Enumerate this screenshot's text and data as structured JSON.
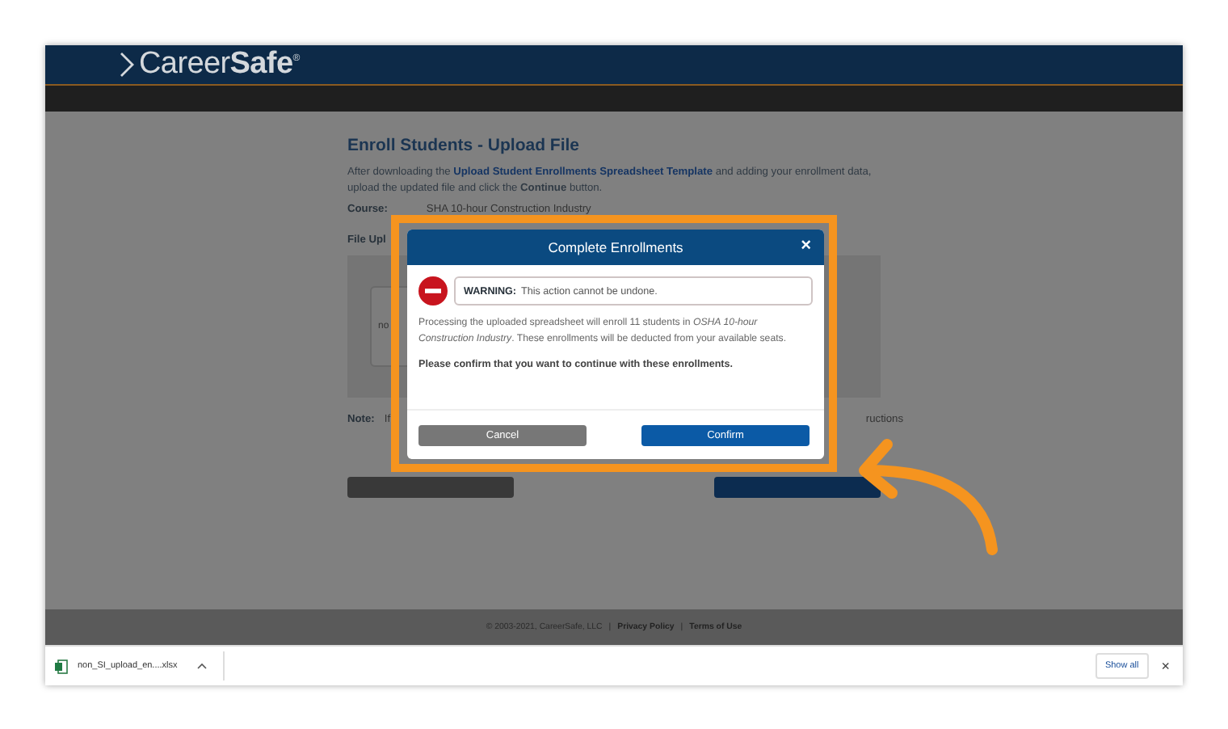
{
  "header": {
    "logo": "Career**Safe**$^{®}$"
  },
  "page": {
    "title": "Enroll Students - Upload File",
    "intro_before": "After downloading the",
    "intro_link": "Upload Student Enrollments Spreadsheet Template",
    "intro_after": "and adding your enrollment data, upload the updated file and click the **Continue** button.",
    "course_label": "Course:",
    "course_value": "SHA 10-hour Construction Industry",
    "file_label": "File Upl",
    "file_fragment": "no",
    "note_label": "Note:",
    "note_text": "If",
    "note_tail": "ructions"
  },
  "dialog": {
    "title": "Complete Enrollments",
    "close": "×",
    "warning_label": "WARNING:",
    "warning_text": "This action cannot be undone.",
    "body": "Processing the uploaded spreadsheet will enroll 11 students in *OSHA 10-hour Construction Industry*. These enrollments will be deducted from your available seats.",
    "prompt": "Please confirm that you want to continue with these enrollments.",
    "buttons": [
      {
        "label": "Cancel",
        "kind": "secondary"
      },
      {
        "label": "Confirm",
        "kind": "primary"
      }
    ]
  },
  "footer": {
    "copyright": "© 2003-2021, CareerSafe, LLC",
    "separator": "|",
    "links": [
      "Privacy Policy",
      "Terms of Use"
    ]
  },
  "download_bar": {
    "file": "non_SI_upload_en....xlsx",
    "show_all": "Show all",
    "close": "×"
  }
}
